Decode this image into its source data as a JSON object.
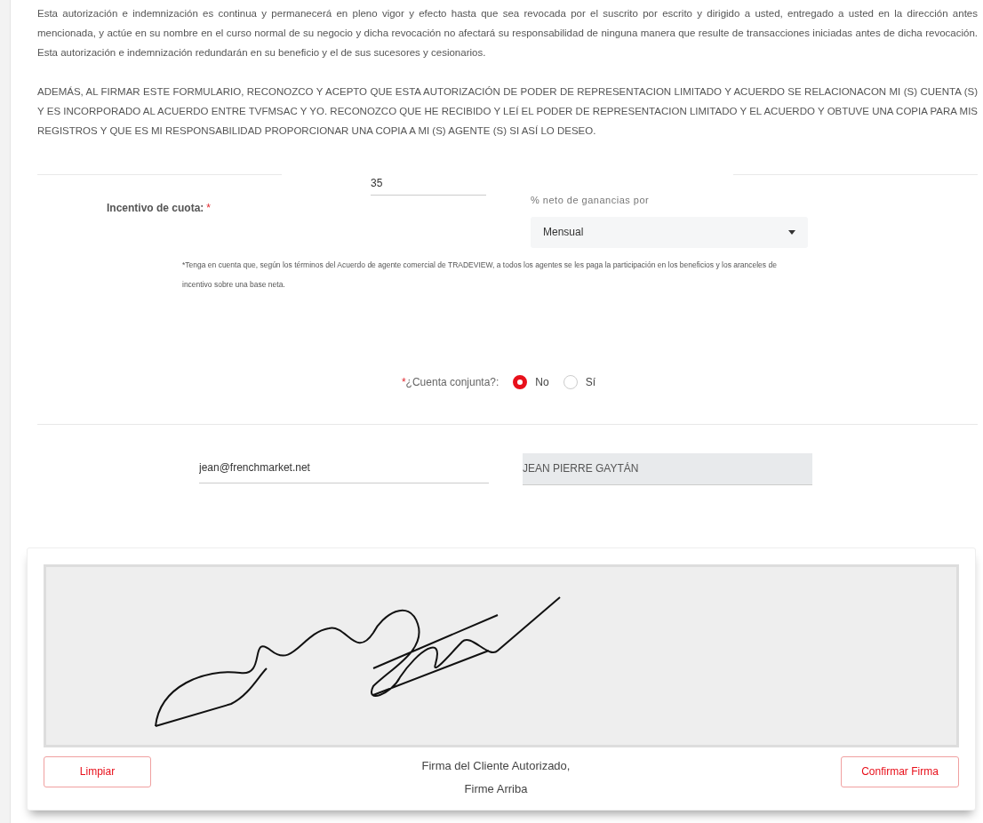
{
  "paragraphs": [
    "Esta autorización e indemnización es continua y permanecerá en pleno vigor y efecto hasta que sea revocada por el suscrito por escrito y dirigido a usted, entregado a usted en la dirección antes mencionada, y actúe en su nombre en el curso normal de su negocio y dicha revocación no afectará su responsabilidad de ninguna manera que resulte de transacciones iniciadas antes de dicha revocación. Esta autorización e indemnización redundarán en su beneficio y el de sus sucesores y cesionarios.",
    "ADEMÁS, AL FIRMAR ESTE FORMULARIO, RECONOZCO Y ACEPTO QUE ESTA AUTORIZACIÓN DE PODER DE REPRESENTACION LIMITADO Y ACUERDO SE RELACIONACON MI (S) CUENTA (S) Y ES INCORPORADO AL ACUERDO ENTRE TVFMSAC Y YO. RECONOZCO QUE HE RECIBIDO Y LEÍ EL PODER DE REPRESENTACION LIMITADO Y EL ACUERDO Y OBTUVE UNA COPIA PARA MIS REGISTROS Y QUE ES MI RESPONSABILIDAD PROPORCIONAR UNA COPIA A MI (S) AGENTE (S) SI ASÍ LO DESEO."
  ],
  "fee_incentive": {
    "label": "Incentivo de cuota:",
    "required_mark": "*",
    "value": "35"
  },
  "net_profit": {
    "label": "% neto de ganancias por",
    "value": "Mensual"
  },
  "note": "*Tenga en cuenta que, según los términos del Acuerdo de agente comercial de TRADEVIEW, a todos los agentes se les paga la participación en los beneficios y los aranceles de incentivo sobre una base neta.",
  "joint_account": {
    "required_mark": "*",
    "label": "¿Cuenta conjunta?:",
    "options": [
      {
        "label": "No",
        "selected": true
      },
      {
        "label": "Sí",
        "selected": false
      }
    ]
  },
  "email": "jean@frenchmarket.net",
  "name": "JEAN PIERRE GAYTÁN",
  "signature": {
    "caption_lines": [
      "Firma del Cliente Autorizado,",
      "Firme Arriba"
    ],
    "buttons": [
      "Limpiar",
      "Confirmar Firma"
    ]
  }
}
